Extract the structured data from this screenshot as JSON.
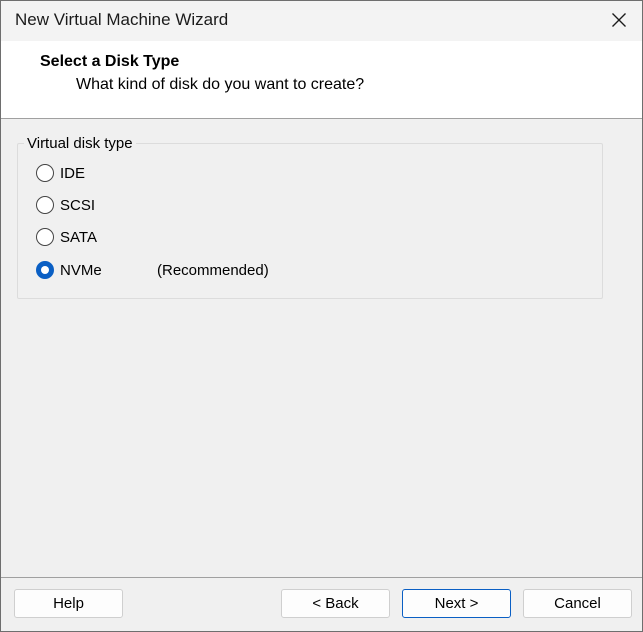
{
  "window": {
    "title": "New Virtual Machine Wizard"
  },
  "header": {
    "title": "Select a Disk Type",
    "subtitle": "What kind of disk do you want to create?"
  },
  "group": {
    "label": "Virtual disk type",
    "options": [
      {
        "label": "IDE",
        "checked": false
      },
      {
        "label": "SCSI",
        "checked": false
      },
      {
        "label": "SATA",
        "checked": false
      },
      {
        "label": "NVMe",
        "checked": true,
        "note": "(Recommended)"
      }
    ]
  },
  "buttons": {
    "help": "Help",
    "back": "< Back",
    "next": "Next >",
    "cancel": "Cancel"
  },
  "colors": {
    "accent": "#0a5fc4"
  }
}
